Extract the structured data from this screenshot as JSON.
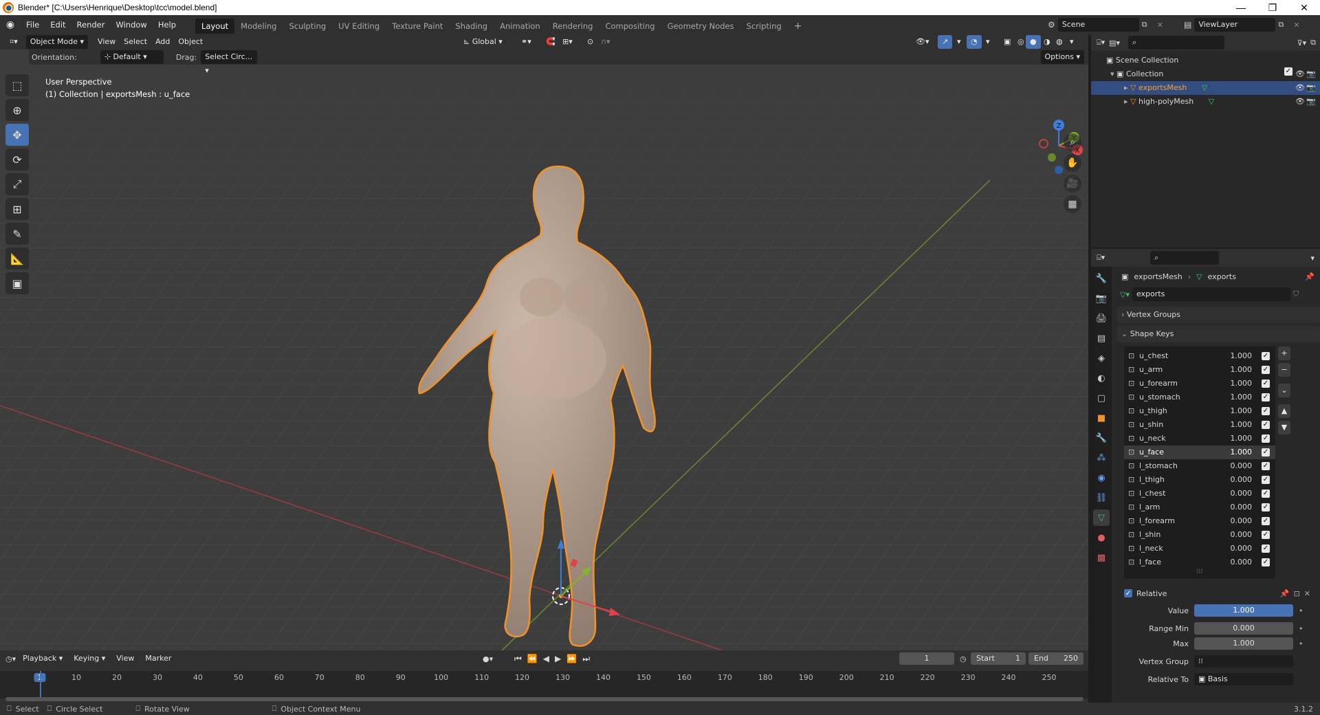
{
  "titlebar": {
    "title": "Blender* [C:\\Users\\Henrique\\Desktop\\tcc\\model.blend]"
  },
  "menu": [
    "File",
    "Edit",
    "Render",
    "Window",
    "Help"
  ],
  "workspaces": [
    "Layout",
    "Modeling",
    "Sculpting",
    "UV Editing",
    "Texture Paint",
    "Shading",
    "Animation",
    "Rendering",
    "Compositing",
    "Geometry Nodes",
    "Scripting"
  ],
  "scene": {
    "name": "Scene",
    "view_layer": "ViewLayer"
  },
  "viewport_header": {
    "mode": "Object Mode",
    "menus": [
      "View",
      "Select",
      "Add",
      "Object"
    ],
    "transform": "Global",
    "options": "Options",
    "orientation_label": "Orientation:",
    "orientation_value": "Default",
    "drag_label": "Drag:",
    "drag_value": "Select Circ..."
  },
  "viewport_overlay": {
    "perspective": "User Perspective",
    "collection": "(1) Collection | exportsMesh : u_face",
    "gizmo_labels": [
      "Z",
      "Y",
      "X"
    ]
  },
  "outliner": {
    "scene_collection": "Scene Collection",
    "collection": "Collection",
    "objects": [
      "exportsMesh",
      "high-polyMesh"
    ]
  },
  "properties": {
    "breadcrumb_object": "exportsMesh",
    "breadcrumb_data": "exports",
    "data_name": "exports",
    "vertex_groups": "Vertex Groups",
    "shape_keys": "Shape Keys",
    "shape_key_list": [
      {
        "name": "u_chest",
        "value": "1.000"
      },
      {
        "name": "u_arm",
        "value": "1.000"
      },
      {
        "name": "u_forearm",
        "value": "1.000"
      },
      {
        "name": "u_stomach",
        "value": "1.000"
      },
      {
        "name": "u_thigh",
        "value": "1.000"
      },
      {
        "name": "u_shin",
        "value": "1.000"
      },
      {
        "name": "u_neck",
        "value": "1.000"
      },
      {
        "name": "u_face",
        "value": "1.000",
        "selected": true
      },
      {
        "name": "l_stomach",
        "value": "0.000"
      },
      {
        "name": "l_thigh",
        "value": "0.000"
      },
      {
        "name": "l_chest",
        "value": "0.000"
      },
      {
        "name": "l_arm",
        "value": "0.000"
      },
      {
        "name": "l_forearm",
        "value": "0.000"
      },
      {
        "name": "l_shin",
        "value": "0.000"
      },
      {
        "name": "l_neck",
        "value": "0.000"
      },
      {
        "name": "l_face",
        "value": "0.000"
      }
    ],
    "relative": "Relative",
    "value_label": "Value",
    "value": "1.000",
    "range_min_label": "Range Min",
    "range_min": "0.000",
    "max_label": "Max",
    "max": "1.000",
    "vertex_group_label": "Vertex Group",
    "relative_to_label": "Relative To",
    "relative_to": "Basis"
  },
  "timeline": {
    "menus": [
      "Playback",
      "Keying",
      "View",
      "Marker"
    ],
    "current_frame": "1",
    "start_label": "Start",
    "start": "1",
    "end_label": "End",
    "end": "250",
    "ruler": [
      "1",
      "10",
      "20",
      "30",
      "40",
      "50",
      "60",
      "70",
      "80",
      "90",
      "100",
      "110",
      "120",
      "130",
      "140",
      "150",
      "160",
      "170",
      "180",
      "190",
      "200",
      "210",
      "220",
      "230",
      "240",
      "250"
    ]
  },
  "statusbar": {
    "select": "Select",
    "circle_select": "Circle Select",
    "rotate_view": "Rotate View",
    "context_menu": "Object Context Menu",
    "version": "3.1.2"
  },
  "colors": {
    "accent": "#4772b3",
    "selection": "#ffa02e",
    "x_axis": "#e0424a",
    "y_axis": "#86b52d",
    "z_axis": "#3c7fdb"
  }
}
